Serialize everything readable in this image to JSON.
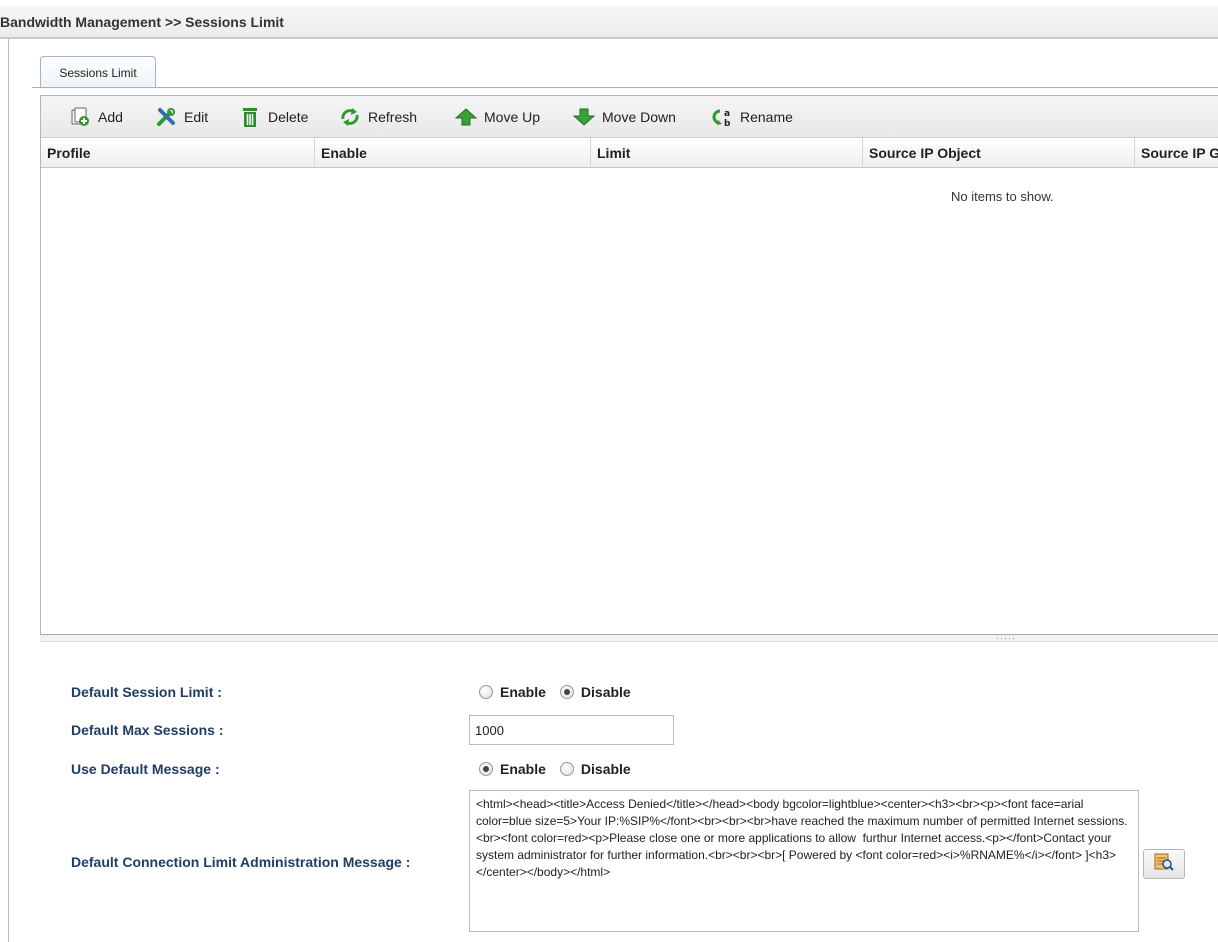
{
  "header": {
    "breadcrumb": "Bandwidth Management >> Sessions Limit"
  },
  "tabs": [
    {
      "label": "Sessions Limit",
      "active": true
    }
  ],
  "toolbar": {
    "add": "Add",
    "edit": "Edit",
    "delete": "Delete",
    "refresh": "Refresh",
    "move_up": "Move Up",
    "move_down": "Move Down",
    "rename": "Rename"
  },
  "grid": {
    "columns": [
      "Profile",
      "Enable",
      "Limit",
      "Source IP Object",
      "Source IP G"
    ],
    "empty_text": "No items to show."
  },
  "settings": {
    "default_session_limit": {
      "label": "Default Session Limit :",
      "options": [
        "Enable",
        "Disable"
      ],
      "selected": "Disable"
    },
    "default_max_sessions": {
      "label": "Default Max Sessions :",
      "value": "1000"
    },
    "use_default_message": {
      "label": "Use Default Message :",
      "options": [
        "Enable",
        "Disable"
      ],
      "selected": "Enable"
    },
    "admin_message": {
      "label": "Default Connection Limit Administration Message :",
      "value": "<html><head><title>Access Denied</title></head><body bgcolor=lightblue><center><h3><br><p><font face=arial color=blue size=5>Your IP:%SIP%</font><br><br><br>have reached the maximum number of permitted Internet sessions.<br><font color=red><p>Please close one or more applications to allow  furthur Internet access.<p></font>Contact your system administrator for further information.<br><br><br>[ Powered by <font color=red><i>%RNAME%</i></font> ]<h3></center></body></html>"
    }
  }
}
